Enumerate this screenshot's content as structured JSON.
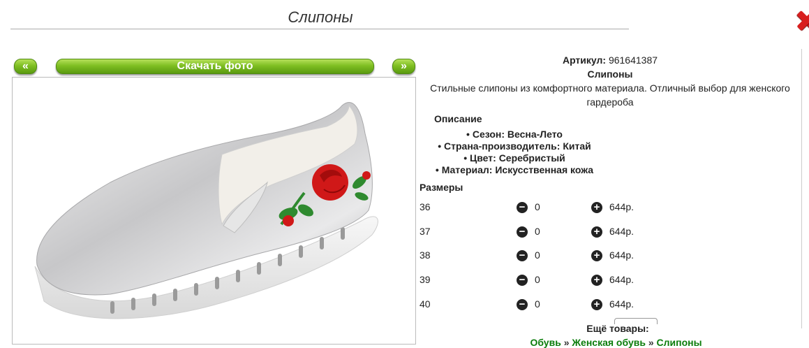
{
  "page": {
    "title": "Слипоны"
  },
  "nav": {
    "prev_label": "«",
    "download_label": "Скачать фото",
    "next_label": "»"
  },
  "product": {
    "article_label": "Артикул:",
    "article_value": "961641387",
    "name": "Слипоны",
    "description": "Стильные слипоны из комфортного материала. Отличный выбор для женского гардероба",
    "specs_title": "Описание",
    "specs": [
      "Сезон: Весна-Лето",
      "Страна-производитель: Китай",
      "Цвет: Серебристый",
      "Материал: Искусственная кожа"
    ]
  },
  "sizes": {
    "title": "Размеры",
    "rows": [
      {
        "size": "36",
        "qty": "0",
        "price": "644р."
      },
      {
        "size": "37",
        "qty": "0",
        "price": "644р."
      },
      {
        "size": "38",
        "qty": "0",
        "price": "644р."
      },
      {
        "size": "39",
        "qty": "0",
        "price": "644р."
      },
      {
        "size": "40",
        "qty": "0",
        "price": "644р."
      }
    ]
  },
  "more": {
    "title": "Ещё товары:",
    "crumbs": [
      "Обувь",
      "Женская обувь",
      "Слипоны"
    ],
    "separator": "»"
  },
  "colors": {
    "button_green": "#7fbf22",
    "link_green": "#0b7d0b",
    "close_red": "#d81e1e",
    "rose_red": "#d01818",
    "leaf_green": "#2f8a2f"
  },
  "icons": {
    "close": "close-icon",
    "minus": "minus-circle-icon",
    "plus": "plus-circle-icon"
  }
}
